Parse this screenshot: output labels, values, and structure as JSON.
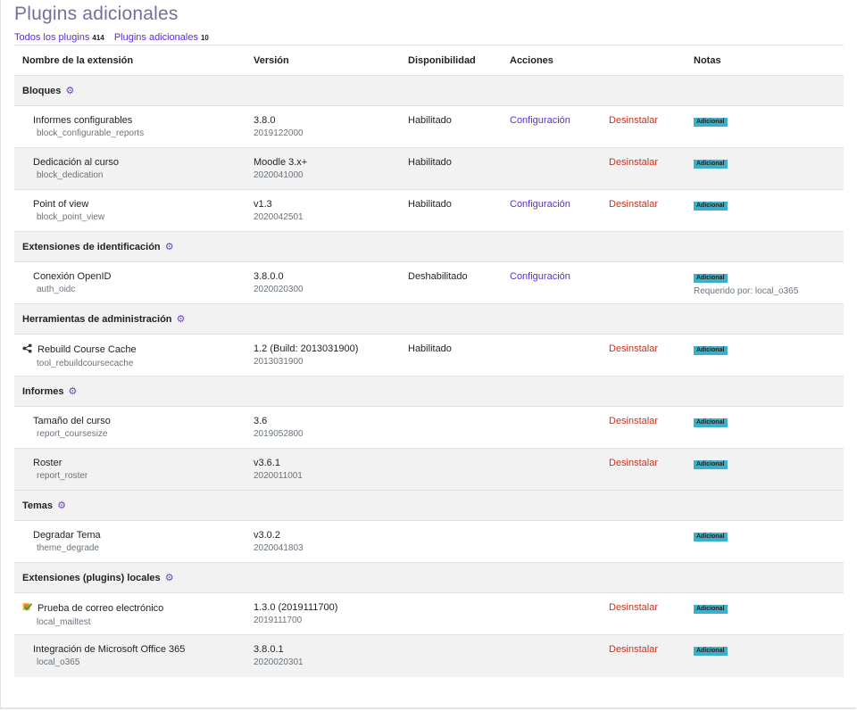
{
  "page": {
    "title": "Plugins adicionales",
    "filters": [
      {
        "label": "Todos los plugins",
        "count": "414"
      },
      {
        "label": "Plugins adicionales",
        "count": "10"
      }
    ]
  },
  "table": {
    "headers": [
      "Nombre de la extensión",
      "Versión",
      "Disponibilidad",
      "Acciones",
      "Notas"
    ],
    "groups": [
      {
        "type": "Bloques",
        "plugins": [
          {
            "name": "Informes configurables",
            "component": "block_configurable_reports",
            "release": "3.8.0",
            "version": "2019122000",
            "availability": "Habilitado",
            "settings": "Configuración",
            "uninstall": "Desinstalar",
            "badge": "Adicional"
          },
          {
            "name": "Dedicación al curso",
            "component": "block_dedication",
            "release": "Moodle 3.x+",
            "version": "2020041000",
            "availability": "Habilitado",
            "settings": "",
            "uninstall": "Desinstalar",
            "badge": "Adicional"
          },
          {
            "name": "Point of view",
            "component": "block_point_view",
            "release": "v1.3",
            "version": "2020042501",
            "availability": "Habilitado",
            "settings": "Configuración",
            "uninstall": "Desinstalar",
            "badge": "Adicional"
          }
        ]
      },
      {
        "type": "Extensiones de identificación",
        "plugins": [
          {
            "name": "Conexión OpenID",
            "component": "auth_oidc",
            "release": "3.8.0.0",
            "version": "2020020300",
            "availability": "Deshabilitado",
            "settings": "Configuración",
            "uninstall": "",
            "badge": "Adicional",
            "required": "Requerido por: local_o365"
          }
        ]
      },
      {
        "type": "Herramientas de administración",
        "plugins": [
          {
            "name": "Rebuild Course Cache",
            "component": "tool_rebuildcoursecache",
            "release": "1.2 (Build: 2013031900)",
            "version": "2013031900",
            "availability": "Habilitado",
            "settings": "",
            "uninstall": "Desinstalar",
            "badge": "Adicional",
            "icon": "share-icon"
          }
        ]
      },
      {
        "type": "Informes",
        "plugins": [
          {
            "name": "Tamaño del curso",
            "component": "report_coursesize",
            "release": "3.6",
            "version": "2019052800",
            "availability": "",
            "settings": "",
            "uninstall": "Desinstalar",
            "badge": "Adicional"
          },
          {
            "name": "Roster",
            "component": "report_roster",
            "release": "v3.6.1",
            "version": "2020011001",
            "availability": "",
            "settings": "",
            "uninstall": "Desinstalar",
            "badge": "Adicional"
          }
        ]
      },
      {
        "type": "Temas",
        "plugins": [
          {
            "name": "Degradar Tema",
            "component": "theme_degrade",
            "release": "v3.0.2",
            "version": "2020041803",
            "availability": "",
            "settings": "",
            "uninstall": "",
            "badge": "Adicional"
          }
        ]
      },
      {
        "type": "Extensiones (plugins) locales",
        "plugins": [
          {
            "name": "Prueba de correo electrónico",
            "component": "local_mailtest",
            "release": "1.3.0 (2019111700)",
            "version": "2019111700",
            "availability": "",
            "settings": "",
            "uninstall": "Desinstalar",
            "badge": "Adicional",
            "icon": "mail-icon"
          },
          {
            "name": "Integración de Microsoft Office 365",
            "component": "local_o365",
            "release": "3.8.0.1",
            "version": "2020020301",
            "availability": "",
            "settings": "",
            "uninstall": "Desinstalar",
            "badge": "Adicional"
          }
        ]
      }
    ]
  },
  "colors": {
    "link": "#5c2bd9",
    "uninstall": "#ca3120",
    "badge": "#3bb0c9",
    "gear": "#6f42c1"
  }
}
